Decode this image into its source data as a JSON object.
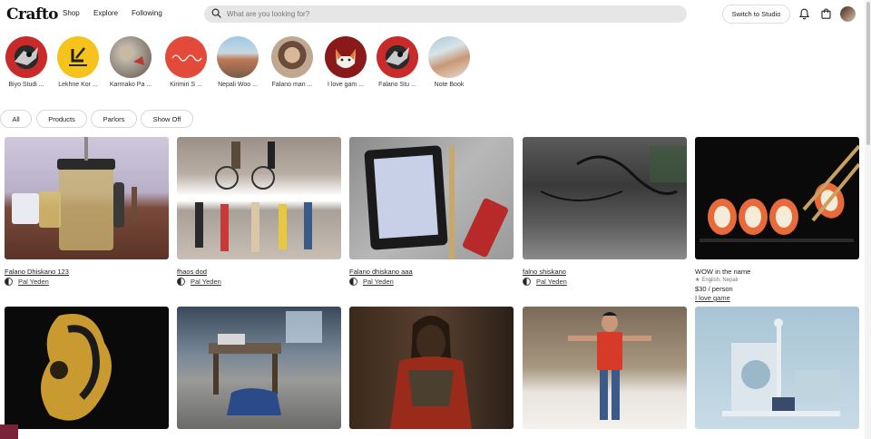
{
  "header": {
    "logo": "Crafto",
    "nav": [
      "Shop",
      "Explore",
      "Following"
    ],
    "search_placeholder": "What are you looking for?",
    "switch_label": "Switch to Studio"
  },
  "stories": [
    {
      "label": "Biyo Studi ..."
    },
    {
      "label": "Lekhne Kor ..."
    },
    {
      "label": "Karmako Pa ..."
    },
    {
      "label": "Kirimiri S ..."
    },
    {
      "label": "Nepali Woo ..."
    },
    {
      "label": "Falano man ..."
    },
    {
      "label": "I love gam ..."
    },
    {
      "label": "Falano Stu ..."
    },
    {
      "label": "Note Book"
    }
  ],
  "filters": [
    "All",
    "Products",
    "Parlors",
    "Show Off"
  ],
  "cards_row1": [
    {
      "title": "Falano Dhiskano 123",
      "author": "Pal Yeden"
    },
    {
      "title": "fhaos dod",
      "author": "Pal Yeden"
    },
    {
      "title": "Falano dhiskano aaa",
      "author": "Pal Yeden"
    },
    {
      "title": "falno shiskano",
      "author": "Pal Yeden"
    },
    {
      "title": "WOW in the name",
      "meta": "English, Nepali",
      "price": "$30 / person",
      "link": "I love game"
    }
  ],
  "colors": {
    "accent": "#7a2238",
    "chip_border": "#d8d8d8",
    "search_bg": "#e6e6e6"
  }
}
